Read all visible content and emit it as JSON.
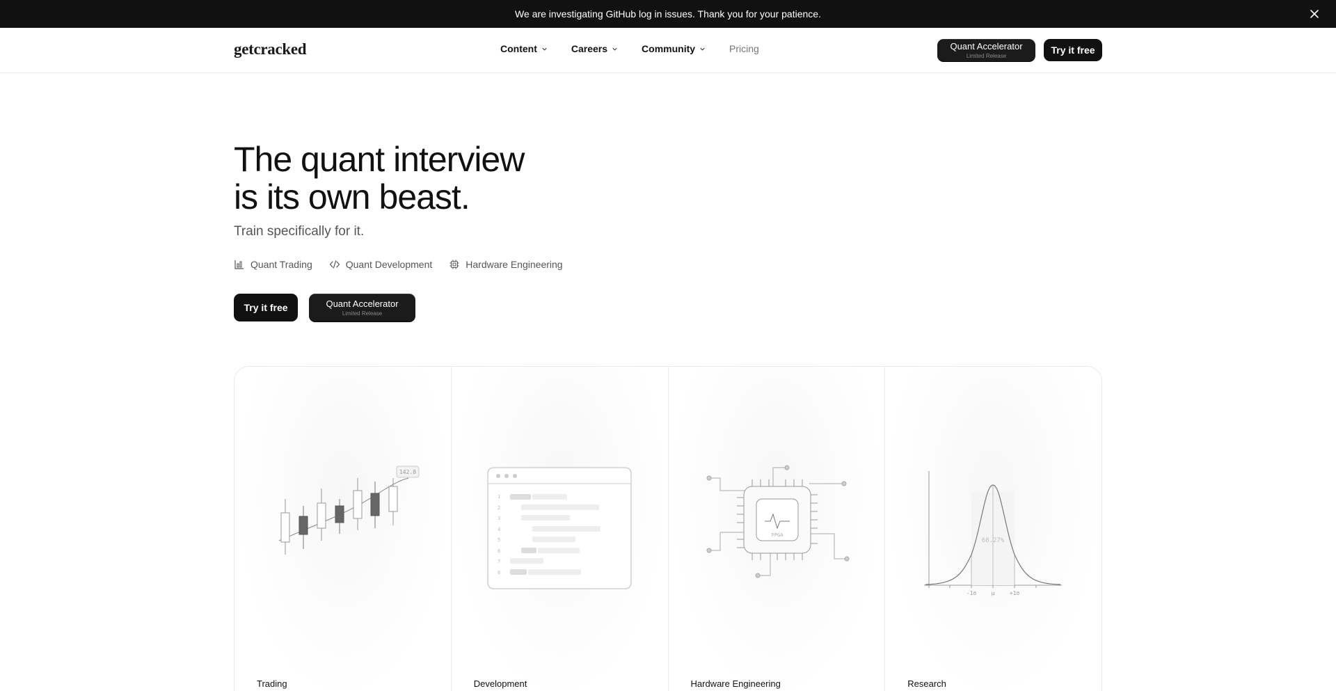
{
  "banner": {
    "text": "We are investigating GitHub log in issues. Thank you for your patience."
  },
  "nav": {
    "logo": "getcracked",
    "items": [
      {
        "label": "Content",
        "dropdown": true
      },
      {
        "label": "Careers",
        "dropdown": true
      },
      {
        "label": "Community",
        "dropdown": true
      },
      {
        "label": "Pricing",
        "dropdown": false
      }
    ],
    "accelerator": {
      "label": "Quant Accelerator",
      "sublabel": "Limited Release"
    },
    "try_label": "Try it free"
  },
  "hero": {
    "title_line1": "The quant interview",
    "title_line2": "is its own beast.",
    "subtitle": "Train specifically for it.",
    "tags": [
      {
        "label": "Quant Trading",
        "icon": "chart-bars-icon"
      },
      {
        "label": "Quant Development",
        "icon": "code-icon"
      },
      {
        "label": "Hardware Engineering",
        "icon": "chip-icon"
      }
    ],
    "try_label": "Try it free",
    "accelerator": {
      "label": "Quant Accelerator",
      "sublabel": "Limited Release"
    }
  },
  "cards": [
    {
      "label": "Trading",
      "badge": "142.8"
    },
    {
      "label": "Development"
    },
    {
      "label": "Hardware Engineering",
      "chip_label": "FPGA"
    },
    {
      "label": "Research",
      "center_label": "68.27%",
      "ticks": [
        "-1σ",
        "μ",
        "+1σ"
      ]
    }
  ]
}
